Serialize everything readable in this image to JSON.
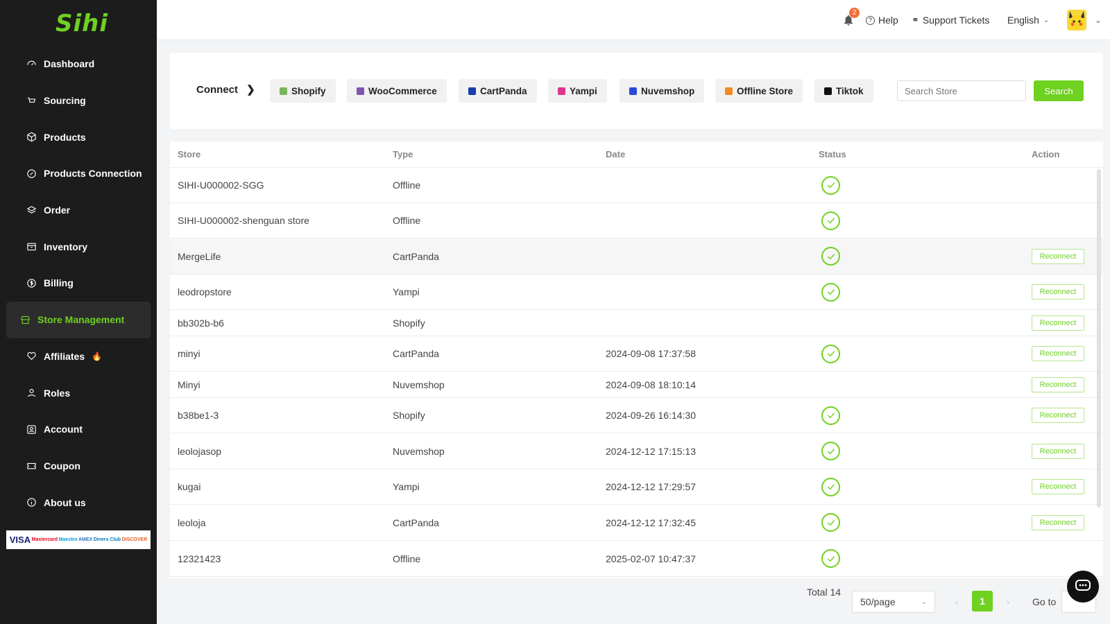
{
  "brand": "Sihi",
  "sidebar": {
    "items": [
      {
        "label": "Dashboard",
        "icon": "dashboard-icon"
      },
      {
        "label": "Sourcing",
        "icon": "cart-icon"
      },
      {
        "label": "Products",
        "icon": "box-icon"
      },
      {
        "label": "Products Connection",
        "icon": "link-icon"
      },
      {
        "label": "Order",
        "icon": "layers-icon"
      },
      {
        "label": "Inventory",
        "icon": "inventory-icon"
      },
      {
        "label": "Billing",
        "icon": "dollar-icon"
      },
      {
        "label": "Store Management",
        "icon": "store-icon",
        "active": true
      },
      {
        "label": "Affiliates",
        "icon": "heart-icon",
        "hot": true
      },
      {
        "label": "Roles",
        "icon": "user-icon"
      },
      {
        "label": "Account",
        "icon": "account-icon"
      },
      {
        "label": "Coupon",
        "icon": "ticket-icon"
      },
      {
        "label": "About us",
        "icon": "info-icon"
      }
    ],
    "payment_cards": [
      "VISA",
      "Mastercard",
      "Maestro",
      "AMEX",
      "Diners Club",
      "DISCOVER"
    ]
  },
  "topbar": {
    "notifications": "2",
    "help": "Help",
    "support": "Support Tickets",
    "language": "English"
  },
  "connect": {
    "label": "Connect",
    "platforms": [
      {
        "name": "Shopify",
        "color": "#7ab55c"
      },
      {
        "name": "WooCommerce",
        "color": "#7f54b3"
      },
      {
        "name": "CartPanda",
        "color": "#1a3ea8"
      },
      {
        "name": "Yampi",
        "color": "#e0358f"
      },
      {
        "name": "Nuvemshop",
        "color": "#2b4bd6"
      },
      {
        "name": "Offline Store",
        "color": "#f28b22"
      },
      {
        "name": "Tiktok",
        "color": "#111111"
      }
    ],
    "search_placeholder": "Search Store",
    "search_button": "Search"
  },
  "table": {
    "headers": [
      "Store",
      "Type",
      "Date",
      "Status",
      "Action"
    ],
    "reconnect_label": "Reconnect",
    "rows": [
      {
        "store": "SIHI-U000002-SGG",
        "type": "Offline",
        "date": "",
        "status": true,
        "action": false
      },
      {
        "store": "SIHI-U000002-shenguan store",
        "type": "Offline",
        "date": "",
        "status": true,
        "action": false
      },
      {
        "store": "MergeLife",
        "type": "CartPanda",
        "date": "",
        "status": true,
        "action": true
      },
      {
        "store": "leodropstore",
        "type": "Yampi",
        "date": "",
        "status": true,
        "action": true
      },
      {
        "store": "bb302b-b6",
        "type": "Shopify",
        "date": "",
        "status": false,
        "action": true
      },
      {
        "store": "minyi",
        "type": "CartPanda",
        "date": "2024-09-08 17:37:58",
        "status": true,
        "action": true
      },
      {
        "store": "Minyi",
        "type": "Nuvemshop",
        "date": "2024-09-08 18:10:14",
        "status": false,
        "action": true
      },
      {
        "store": "b38be1-3",
        "type": "Shopify",
        "date": "2024-09-26 16:14:30",
        "status": true,
        "action": true
      },
      {
        "store": "leolojasop",
        "type": "Nuvemshop",
        "date": "2024-12-12 17:15:13",
        "status": true,
        "action": true
      },
      {
        "store": "kugai",
        "type": "Yampi",
        "date": "2024-12-12 17:29:57",
        "status": true,
        "action": true
      },
      {
        "store": "leoloja",
        "type": "CartPanda",
        "date": "2024-12-12 17:32:45",
        "status": true,
        "action": true
      },
      {
        "store": "12321423",
        "type": "Offline",
        "date": "2025-02-07 10:47:37",
        "status": true,
        "action": false
      }
    ]
  },
  "pagination": {
    "total": "Total 14",
    "page_size": "50/page",
    "current": "1",
    "goto": "Go to"
  }
}
